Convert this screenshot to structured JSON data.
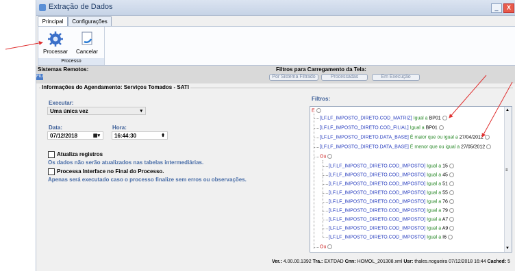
{
  "window": {
    "title": "Extração de Dados",
    "minimize": "_",
    "close": "X"
  },
  "tabs": [
    "Principal",
    "Configurações"
  ],
  "ribbon": {
    "processar": "Processar",
    "cancelar": "Cancelar",
    "group": "Processo"
  },
  "bar": {
    "remotes": "Sistemas Remotos:",
    "remote_value": "FILI",
    "filters_title": "Filtros para Carregamento da Tela:",
    "btn_filtered": "Por Sistema Filtrado",
    "btn_processed": "Processadas",
    "btn_running": "Em Execução"
  },
  "agenda": {
    "legend": "Informações do Agendamento:  Serviços Tomados - SATI",
    "executar_label": "Executar:",
    "executar_value": "Uma única vez",
    "data_label": "Data:",
    "data_value": "07/12/2018",
    "hora_label": "Hora:",
    "hora_value": "16:44:30",
    "atualiza_label": "Atualiza registros",
    "atualiza_note": "Os dados não serão atualizados nas tabelas intermediárias.",
    "processa_label": "Processa Interface no Final do Processo.",
    "processa_note": "Apenas será executado caso o processo finalize sem erros ou observações."
  },
  "filters": {
    "label": "Filtros:",
    "root": "E",
    "ou": "Ou",
    "items": [
      {
        "field": "[LF.LF_IMPOSTO_DIRETO.COD_MATRIZ]",
        "op": "Igual a",
        "value": "BP01"
      },
      {
        "field": "[LF.LF_IMPOSTO_DIRETO.COD_FILIAL]",
        "op": "Igual a",
        "value": "BP01"
      },
      {
        "field": "[LF.LF_IMPOSTO_DIRETO.DATA_BASE]",
        "op": "É maior que ou igual a",
        "value": "27/04/2012"
      },
      {
        "field": "[LF.LF_IMPOSTO_DIRETO.DATA_BASE]",
        "op": "É menor que ou igual a",
        "value": "27/05/2012"
      }
    ],
    "sub": [
      {
        "field": "[LF.LF_IMPOSTO_DIRETO.COD_IMPOSTO]",
        "op": "Igual a",
        "value": "15"
      },
      {
        "field": "[LF.LF_IMPOSTO_DIRETO.COD_IMPOSTO]",
        "op": "Igual a",
        "value": "45"
      },
      {
        "field": "[LF.LF_IMPOSTO_DIRETO.COD_IMPOSTO]",
        "op": "Igual a",
        "value": "51"
      },
      {
        "field": "[LF.LF_IMPOSTO_DIRETO.COD_IMPOSTO]",
        "op": "Igual a",
        "value": "55"
      },
      {
        "field": "[LF.LF_IMPOSTO_DIRETO.COD_IMPOSTO]",
        "op": "Igual a",
        "value": "76"
      },
      {
        "field": "[LF.LF_IMPOSTO_DIRETO.COD_IMPOSTO]",
        "op": "Igual a",
        "value": "79"
      },
      {
        "field": "[LF.LF_IMPOSTO_DIRETO.COD_IMPOSTO]",
        "op": "Igual a",
        "value": "A7"
      },
      {
        "field": "[LF.LF_IMPOSTO_DIRETO.COD_IMPOSTO]",
        "op": "Igual a",
        "value": "A9"
      },
      {
        "field": "[LF.LF_IMPOSTO_DIRETO.COD_IMPOSTO]",
        "op": "Igual a",
        "value": "I6"
      }
    ]
  },
  "status": {
    "ver_l": "Ver.:",
    "ver": "4.00.00.1392",
    "tra_l": "Tra.:",
    "tra": "EXTDAD",
    "cnn_l": "Cnn:",
    "cnn": "HOMOL_201308.xml",
    "usr_l": "Usr:",
    "usr": "thales.nogueira  07/12/2018  16:44",
    "cached_l": "Cached:",
    "cached": "5"
  }
}
